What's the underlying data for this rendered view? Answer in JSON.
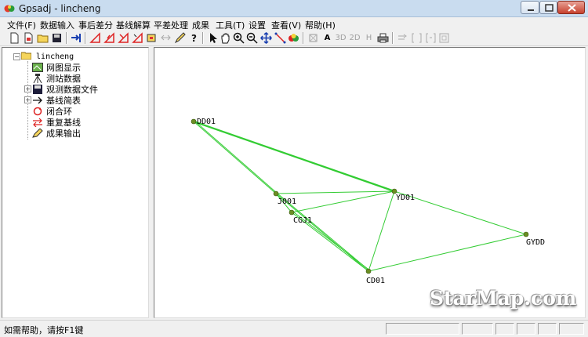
{
  "window": {
    "title": "Gpsadj - lincheng"
  },
  "menu": [
    "文件(F)",
    "数据输入",
    "事后差分",
    "基线解算",
    "平差处理",
    "成果",
    "工具(T)",
    "设置",
    "查看(V)",
    "帮助(H)"
  ],
  "toolbar": {
    "text_buttons": [
      "A",
      "3D",
      "2D",
      "H"
    ]
  },
  "tree": {
    "root": "lincheng",
    "items": [
      {
        "label": "网图显示",
        "icon": "map-icon"
      },
      {
        "label": "测站数据",
        "icon": "tripod-icon"
      },
      {
        "label": "观测数据文件",
        "icon": "disk-icon"
      },
      {
        "label": "基线简表",
        "icon": "arrow-icon"
      },
      {
        "label": "闭合环",
        "icon": "loop-icon"
      },
      {
        "label": "重复基线",
        "icon": "repeat-icon"
      },
      {
        "label": "成果输出",
        "icon": "pencil-icon"
      }
    ]
  },
  "network": {
    "line_color": "#33cc33",
    "point_color": "#6b8e23",
    "stations": [
      "DD01",
      "J001",
      "CGJ1",
      "YD01",
      "GYDD",
      "CD01"
    ]
  },
  "watermark": "StarMap.com",
  "status": {
    "help_text": "如需帮助，请按F1键"
  }
}
